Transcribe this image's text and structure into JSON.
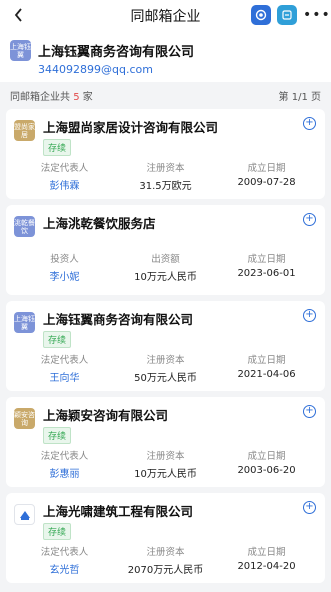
{
  "header": {
    "title": "同邮箱企业"
  },
  "company": {
    "logo_text": "上海钰翼",
    "name": "上海钰翼商务咨询有限公司",
    "email": "344092899@qq.com"
  },
  "summary": {
    "prefix": "同邮箱企业共",
    "count": "5",
    "suffix": "家",
    "page": "第 1/1 页"
  },
  "results": [
    {
      "logo_text": "盟尚家居",
      "logo_color": "#c9a96a",
      "name": "上海盟尚家居设计咨询有限公司",
      "status": "存续",
      "rep_label": "法定代表人",
      "rep": "彭伟霖",
      "cap_label": "注册资本",
      "cap": "31.5万欧元",
      "date_label": "成立日期",
      "date": "2009-07-28"
    },
    {
      "logo_text": "洮乾餐饮",
      "logo_color": "#7d93d8",
      "name": "上海洮乾餐饮服务店",
      "status": "",
      "rep_label": "投资人",
      "rep": "李小妮",
      "cap_label": "出资额",
      "cap": "10万元人民币",
      "date_label": "成立日期",
      "date": "2023-06-01"
    },
    {
      "logo_text": "上海钰翼",
      "logo_color": "#7d93d8",
      "name": "上海钰翼商务咨询有限公司",
      "status": "存续",
      "rep_label": "法定代表人",
      "rep": "王向华",
      "cap_label": "注册资本",
      "cap": "50万元人民币",
      "date_label": "成立日期",
      "date": "2021-04-06"
    },
    {
      "logo_text": "颖安咨询",
      "logo_color": "#c9a96a",
      "name": "上海颖安咨询有限公司",
      "status": "存续",
      "rep_label": "法定代表人",
      "rep": "彭惠丽",
      "cap_label": "注册资本",
      "cap": "10万元人民币",
      "date_label": "成立日期",
      "date": "2003-06-20"
    },
    {
      "logo_text": "",
      "logo_color": "#ffffff",
      "name": "上海光啸建筑工程有限公司",
      "status": "存续",
      "rep_label": "法定代表人",
      "rep": "玄光哲",
      "cap_label": "注册资本",
      "cap": "2070万元人民币",
      "date_label": "成立日期",
      "date": "2012-04-20"
    }
  ],
  "icons": {
    "back": "chevron-left-icon",
    "top1": "circle-logo-icon",
    "top2": "app-icon",
    "more": "more-icon",
    "plus": "plus-circle-icon"
  }
}
